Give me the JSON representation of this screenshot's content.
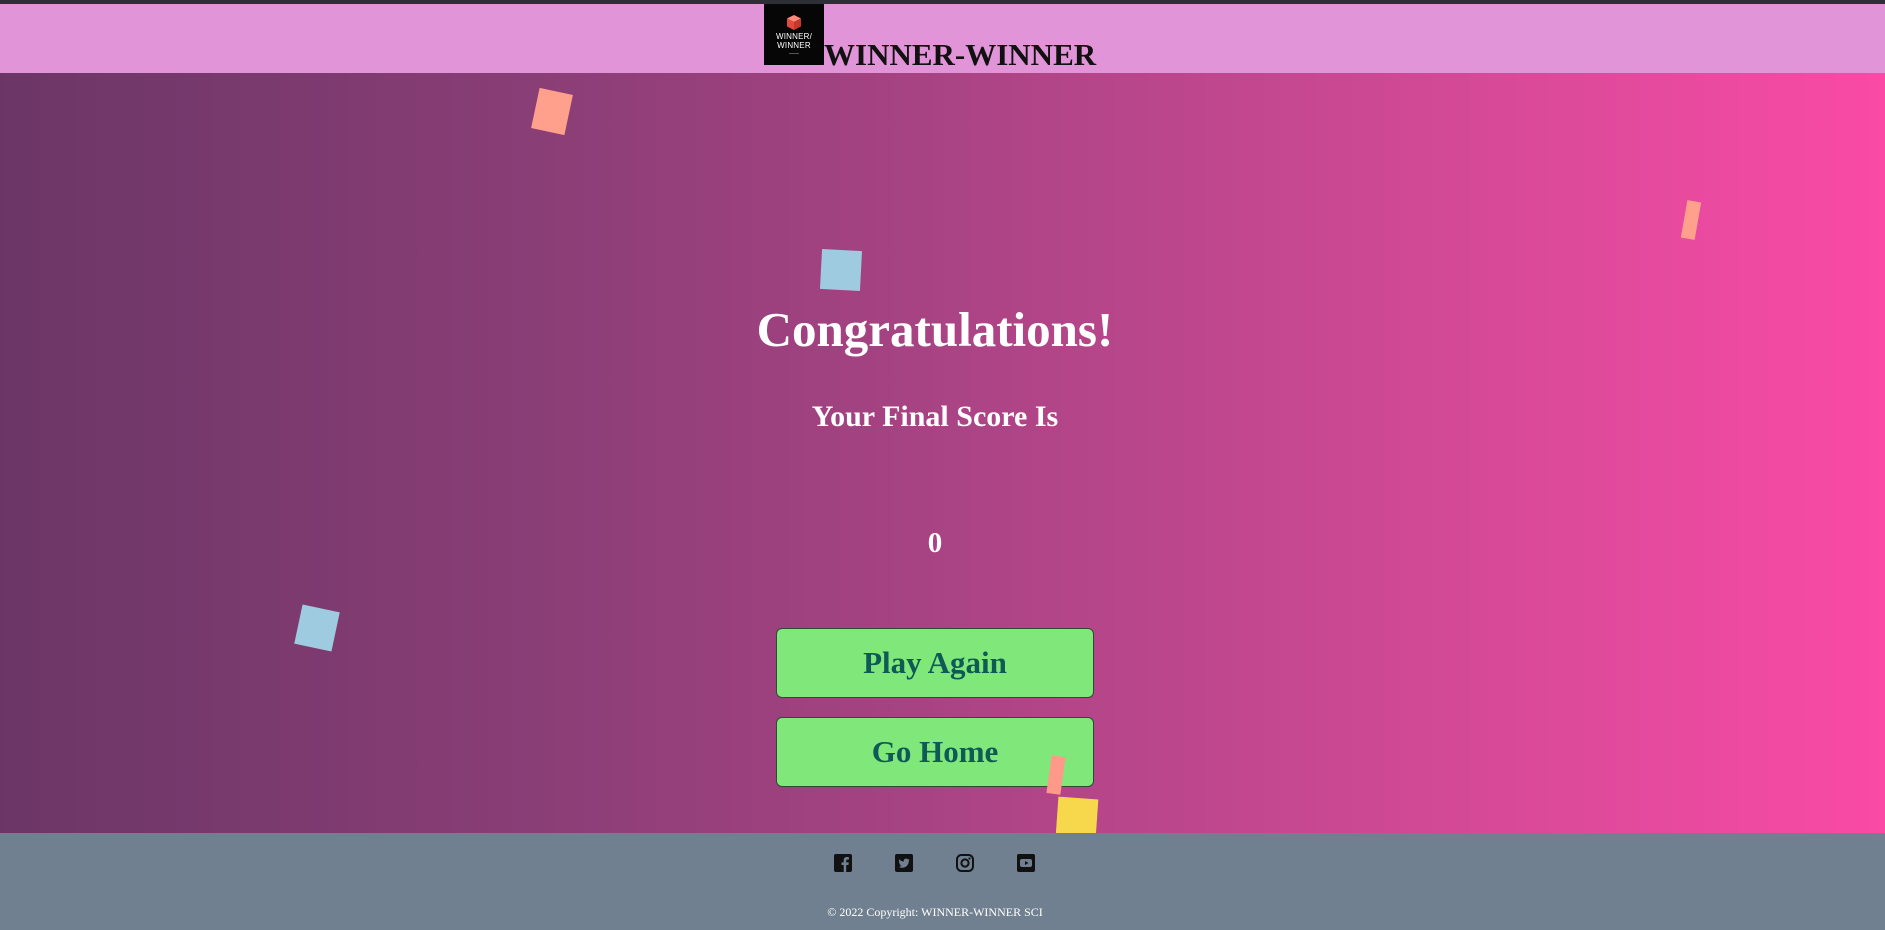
{
  "header": {
    "logo_text_line1": "WINNER/",
    "logo_text_line2": "WINNER",
    "brand_title": "WINNER-WINNER"
  },
  "main": {
    "heading": "Congratulations!",
    "score_label": "Your Final Score Is",
    "score_value": "0",
    "play_again_label": "Play Again",
    "go_home_label": "Go Home"
  },
  "footer": {
    "social_icons": [
      "facebook-icon",
      "twitter-icon",
      "instagram-icon",
      "youtube-icon"
    ],
    "copyright": "© 2022 Copyright: WINNER-WINNER SCI"
  },
  "colors": {
    "header_bg": "#e294d8",
    "gradient_start": "#6b3666",
    "gradient_end": "#fa4aa6",
    "button_bg": "#80e87a",
    "button_text": "#0e5a56",
    "footer_bg": "#718090",
    "confetti": [
      "#ffa08c",
      "#9ecbe0",
      "#ffa08c",
      "#9ecbe0",
      "#ff9a8a",
      "#f7d84d"
    ]
  }
}
